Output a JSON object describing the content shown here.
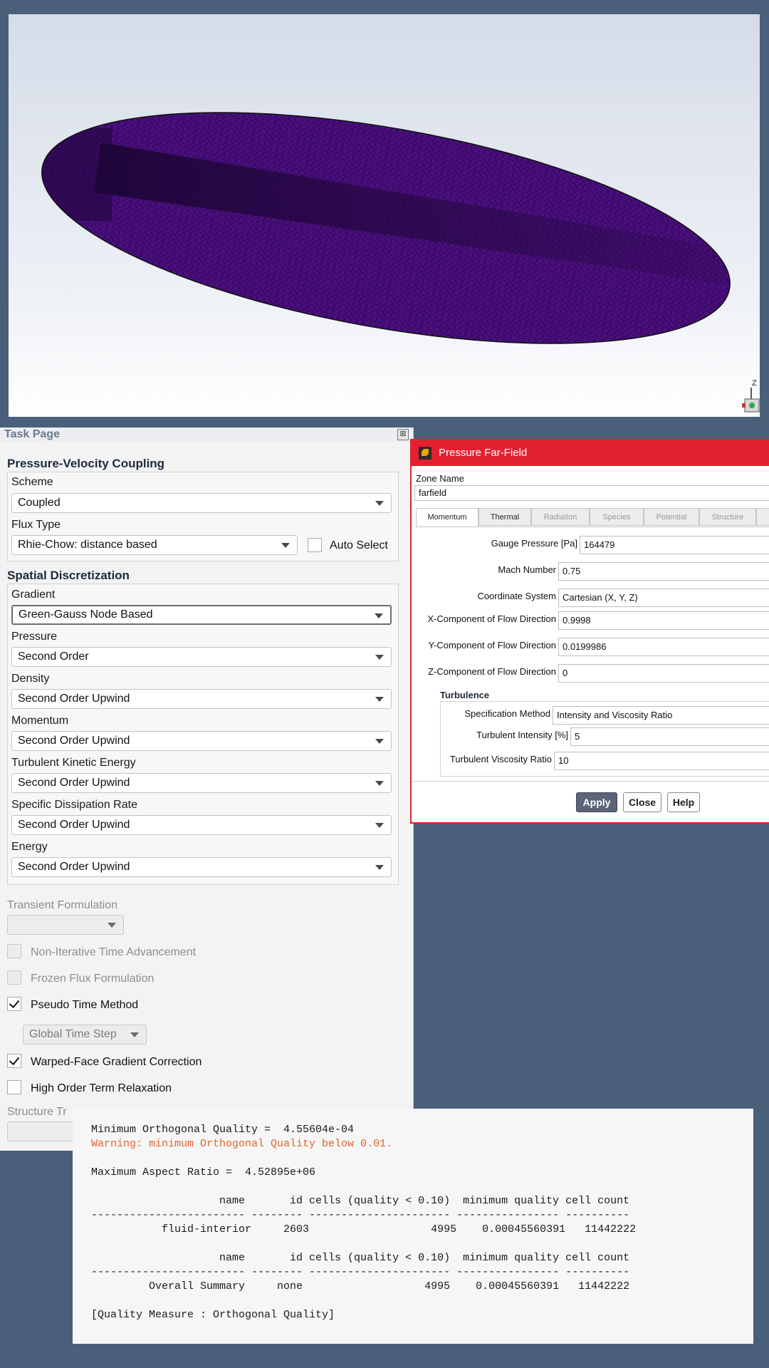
{
  "viewport": {
    "mesh_color": "#4b0f7e",
    "triad_axis_label": "Z"
  },
  "task_page": {
    "title": "Task Page",
    "pvc_section": "Pressure-Velocity Coupling",
    "scheme_label": "Scheme",
    "scheme_value": "Coupled",
    "flux_type_label": "Flux Type",
    "flux_type_value": "Rhie-Chow: distance based",
    "auto_select_label": "Auto Select",
    "spatial_section": "Spatial Discretization",
    "fields": [
      {
        "label": "Gradient",
        "value": "Green-Gauss Node Based"
      },
      {
        "label": "Pressure",
        "value": "Second Order"
      },
      {
        "label": "Density",
        "value": "Second Order Upwind"
      },
      {
        "label": "Momentum",
        "value": "Second Order Upwind"
      },
      {
        "label": "Turbulent Kinetic Energy",
        "value": "Second Order Upwind"
      },
      {
        "label": "Specific Dissipation Rate",
        "value": "Second Order Upwind"
      },
      {
        "label": "Energy",
        "value": "Second Order Upwind"
      }
    ],
    "transient_label": "Transient Formulation",
    "transient_value": "",
    "options": [
      {
        "label": "Non-Iterative Time Advancement",
        "checked": false,
        "enabled": false
      },
      {
        "label": "Frozen Flux Formulation",
        "checked": false,
        "enabled": false
      },
      {
        "label": "Pseudo Time Method",
        "checked": true,
        "enabled": true
      }
    ],
    "time_step_value": "Global Time Step",
    "options2": [
      {
        "label": "Warped-Face Gradient Correction",
        "checked": true,
        "enabled": true
      },
      {
        "label": "High Order Term Relaxation",
        "checked": false,
        "enabled": true
      }
    ],
    "structure_label": "Structure Tr"
  },
  "dialog": {
    "title": "Pressure Far-Field",
    "zone_name_label": "Zone Name",
    "zone_name_value": "farfield",
    "tabs": [
      "Momentum",
      "Thermal",
      "Radiation",
      "Species",
      "Potential",
      "Structure"
    ],
    "fields": [
      {
        "label": "Gauge Pressure [Pa]",
        "value": "164479"
      },
      {
        "label": "Mach Number",
        "value": "0.75"
      },
      {
        "label": "Coordinate System",
        "value": "Cartesian (X, Y, Z)"
      },
      {
        "label": "X-Component of Flow Direction",
        "value": "0.9998"
      },
      {
        "label": "Y-Component of Flow Direction",
        "value": "0.0199986"
      },
      {
        "label": "Z-Component of Flow Direction",
        "value": "0"
      }
    ],
    "turbulence_title": "Turbulence",
    "turbulence_fields": [
      {
        "label": "Specification Method",
        "value": "Intensity and Viscosity Ratio"
      },
      {
        "label": "Turbulent Intensity [%]",
        "value": "5"
      },
      {
        "label": "Turbulent Viscosity Ratio",
        "value": "10"
      }
    ],
    "buttons": {
      "apply": "Apply",
      "close": "Close",
      "help": "Help"
    },
    "accent_color": "#e3202f"
  },
  "console": {
    "line1": "Minimum Orthogonal Quality =  4.55604e-04",
    "warning": "Warning: minimum Orthogonal Quality below 0.01.",
    "line3": "Maximum Aspect Ratio =  4.52895e+06",
    "header": "                    name       id cells (quality < 0.10)  minimum quality cell count",
    "rule": "------------------------ -------- ---------------------- ---------------- ----------",
    "row1": "           fluid-interior     2603                   4995    0.00045560391   11442222",
    "row2": "         Overall Summary     none                   4995    0.00045560391   11442222",
    "footer": "[Quality Measure : Orthogonal Quality]"
  }
}
